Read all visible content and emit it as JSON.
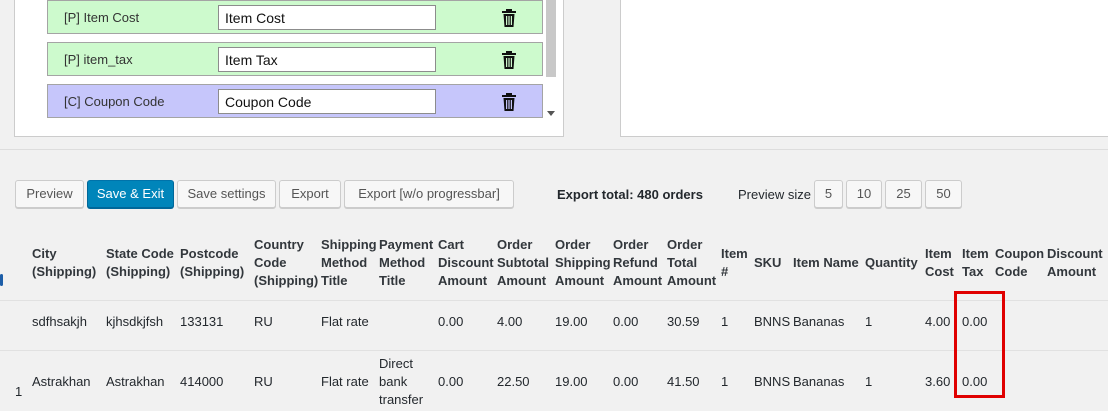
{
  "fields": [
    {
      "tag": "[P]",
      "label": "[P] Item Cost",
      "value": "Item Cost",
      "type": "p"
    },
    {
      "tag": "[P]",
      "label": "[P] item_tax",
      "value": "Item Tax",
      "type": "p"
    },
    {
      "tag": "[C]",
      "label": "[C] Coupon Code",
      "value": "Coupon Code",
      "type": "c"
    }
  ],
  "toolbar": {
    "preview": "Preview",
    "save_exit": "Save & Exit",
    "save_settings": "Save settings",
    "export": "Export",
    "export_no_progress": "Export [w/o progressbar]",
    "export_total": "Export total: 480 orders",
    "preview_size_label": "Preview size",
    "sizes": [
      "5",
      "10",
      "25",
      "50"
    ]
  },
  "colors": {
    "product_field_bg": "#cdfacd",
    "coupon_field_bg": "#c6c6fb",
    "primary_button": "#0085ba",
    "highlight": "#e00000"
  },
  "table": {
    "headers": [
      [
        "City",
        "(Shipping)"
      ],
      [
        "State Code",
        "(Shipping)"
      ],
      [
        "Postcode",
        "(Shipping)"
      ],
      [
        "Country",
        "Code",
        "(Shipping)"
      ],
      [
        "Shipping",
        "Method",
        "Title"
      ],
      [
        "Payment",
        "Method",
        "Title"
      ],
      [
        "Cart",
        "Discount",
        "Amount"
      ],
      [
        "Order",
        "Subtotal",
        "Amount"
      ],
      [
        "Order",
        "Shipping",
        "Amount"
      ],
      [
        "Order",
        "Refund",
        "Amount"
      ],
      [
        "Order",
        "Total",
        "Amount"
      ],
      [
        "Item",
        "#"
      ],
      [
        "SKU"
      ],
      [
        "Item Name"
      ],
      [
        "Quantity"
      ],
      [
        "Item",
        "Cost"
      ],
      [
        "Item",
        "Tax"
      ],
      [
        "Coupon",
        "Code"
      ],
      [
        "Discount",
        "Amount"
      ]
    ],
    "rows": [
      {
        "row_marker": "",
        "cells": [
          "sdfhsakjh",
          "kjhsdkjfsh",
          "133131",
          "RU",
          "Flat rate",
          [],
          "0.00",
          "4.00",
          "19.00",
          "0.00",
          "30.59",
          "1",
          "BNNS",
          "Bananas",
          "1",
          "4.00",
          "0.00",
          "",
          ""
        ]
      },
      {
        "row_marker": "1",
        "cells": [
          "Astrakhan",
          "Astrakhan",
          "414000",
          "RU",
          "Flat rate",
          [
            "Direct",
            "bank",
            "transfer"
          ],
          "0.00",
          "22.50",
          "19.00",
          "0.00",
          "41.50",
          "1",
          "BNNS",
          "Bananas",
          "1",
          "3.60",
          "0.00",
          "",
          ""
        ]
      }
    ]
  }
}
